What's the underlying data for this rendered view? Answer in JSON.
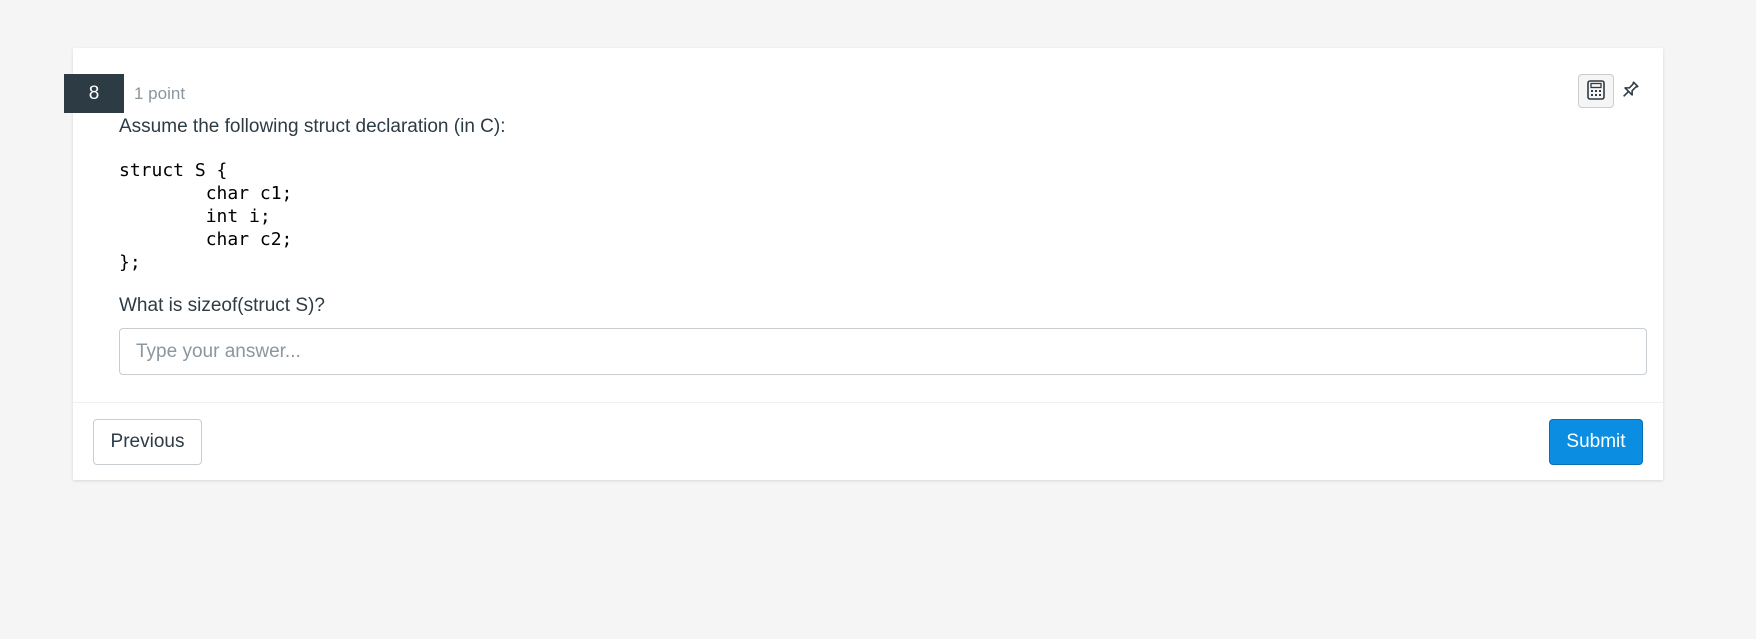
{
  "question": {
    "number": "8",
    "points": "1 point",
    "prompt": "Assume the following struct declaration (in C):",
    "code": "struct S {\n        char c1;\n        int i;\n        char c2;\n};",
    "follow_up": "What is sizeof(struct S)?",
    "answer_value": "",
    "answer_placeholder": "Type your answer..."
  },
  "tools": {
    "calculator_icon": "calculator-icon",
    "pin_icon": "pin-icon"
  },
  "footer": {
    "previous_label": "Previous",
    "submit_label": "Submit"
  },
  "colors": {
    "badge_bg": "#2d3b45",
    "submit_bg": "#0b8ee1",
    "page_bg": "#f5f5f5"
  }
}
